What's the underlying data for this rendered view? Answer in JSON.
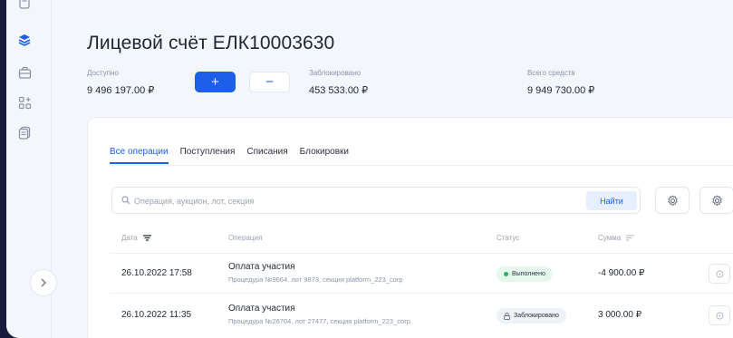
{
  "account": {
    "title": "Лицевой счёт ЕЛК10003630",
    "available_label": "Доступно",
    "available_value": "9 496 197.00 ₽",
    "blocked_label": "Заблокировано",
    "blocked_value": "453 533.00 ₽",
    "total_label": "Всего средств",
    "total_value": "9 949 730.00 ₽",
    "plus_label": "+",
    "minus_label": "−"
  },
  "tabs": [
    {
      "label": "Все операции",
      "active": true
    },
    {
      "label": "Поступления",
      "active": false
    },
    {
      "label": "Списания",
      "active": false
    },
    {
      "label": "Блокировки",
      "active": false
    }
  ],
  "search": {
    "placeholder": "Операция, аукцион, лот, секция",
    "value": "",
    "button_label": "Найти"
  },
  "table": {
    "headers": {
      "date": "Дата",
      "operation": "Операция",
      "status": "Статус",
      "sum": "Сумма"
    },
    "rows": [
      {
        "date": "26.10.2022 17:58",
        "title": "Оплата участия",
        "subtitle": "Процедура №9664, лот 9873, секция platform_223_corp",
        "status": "Выполнено",
        "sum": "-4 900.00 ₽"
      },
      {
        "date": "26.10.2022 11:35",
        "title": "Оплата участия",
        "subtitle": "Процедура №26704, лот 27477, секция platform_223_corp",
        "status": "Заблокировано",
        "sum": "3 000.00 ₽"
      }
    ]
  },
  "colors": {
    "accent": "#1d5fe8",
    "background": "#f3f6fb",
    "outer": "#151b3d",
    "success": "#2fb26a"
  },
  "icons": {
    "rail": [
      "document-icon",
      "stack-icon",
      "briefcase-icon",
      "apps-icon",
      "files-icon"
    ],
    "toggle": "chevron-right-icon",
    "search": "search-icon",
    "settings": "gear-icon",
    "filter": "gear-icon",
    "sort": "sort-icon",
    "row_action": "info-icon"
  }
}
